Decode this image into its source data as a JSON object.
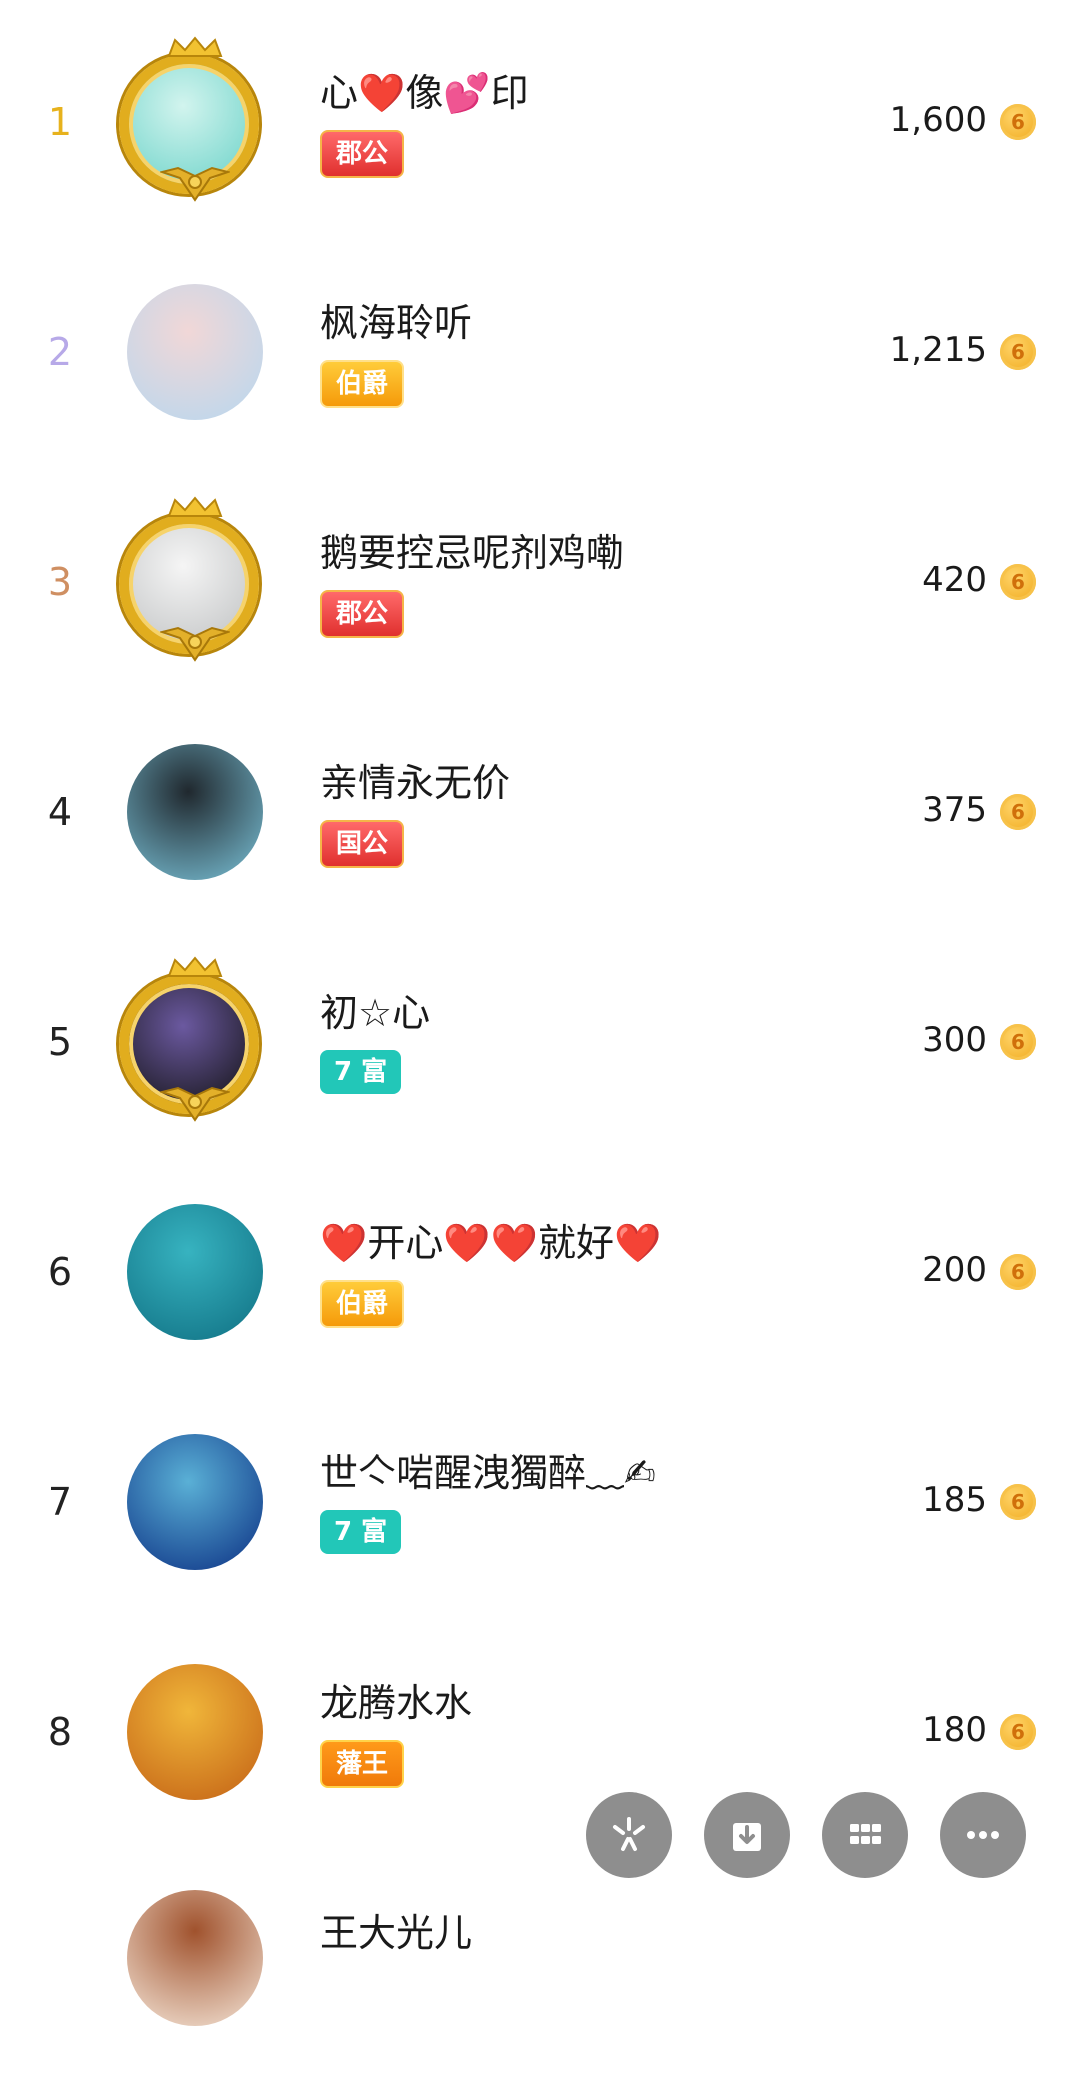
{
  "leaderboard": [
    {
      "rank": "1",
      "name": "心❤️像💕印",
      "badge": "郡公",
      "score": "1,600",
      "rank_color": "#e7b21d",
      "badge_style": "red",
      "avatar_colors": [
        "#6ad2c8",
        "#d2f4ee"
      ],
      "framed": true
    },
    {
      "rank": "2",
      "name": "枫海聆听",
      "badge": "伯爵",
      "score": "1,215",
      "rank_color": "#b7a9e8",
      "badge_style": "orange",
      "avatar_colors": [
        "#b7d7ef",
        "#f1d7d7"
      ],
      "framed": false
    },
    {
      "rank": "3",
      "name": "鹅要控忌呢剂鸡嘞",
      "badge": "郡公",
      "score": "420",
      "rank_color": "#cf8f62",
      "badge_style": "red",
      "avatar_colors": [
        "#bfc1c2",
        "#f5f5f5"
      ],
      "framed": true
    },
    {
      "rank": "4",
      "name": "亲情永无价",
      "badge": "国公",
      "score": "375",
      "rank_color": "#222222",
      "badge_style": "red",
      "avatar_colors": [
        "#7bc3d9",
        "#20282e"
      ],
      "framed": false
    },
    {
      "rank": "5",
      "name": "初☆心",
      "badge": "7 富",
      "score": "300",
      "rank_color": "#222222",
      "badge_style": "teal",
      "avatar_colors": [
        "#111111",
        "#6b59a0"
      ],
      "framed": true
    },
    {
      "rank": "6",
      "name": "❤️开心❤️❤️就好❤️",
      "badge": "伯爵",
      "score": "200",
      "rank_color": "#222222",
      "badge_style": "orange",
      "avatar_colors": [
        "#0f6f82",
        "#37b3c0"
      ],
      "framed": false
    },
    {
      "rank": "7",
      "name": "世亽啱醒洩獨醉﹏✍",
      "badge": "7 富",
      "score": "185",
      "rank_color": "#222222",
      "badge_style": "teal",
      "avatar_colors": [
        "#0b2f83",
        "#5ab0d6"
      ],
      "framed": false
    },
    {
      "rank": "8",
      "name": "龙腾水水",
      "badge": "藩王",
      "score": "180",
      "rank_color": "#222222",
      "badge_style": "king",
      "avatar_colors": [
        "#c25f14",
        "#f0b63a"
      ],
      "framed": false
    }
  ],
  "partial_row": {
    "name": "王大光儿"
  },
  "coin_icon_text": "6",
  "fabs": [
    {
      "icon": "share-icon"
    },
    {
      "icon": "download-icon"
    },
    {
      "icon": "grid-icon"
    },
    {
      "icon": "more-icon"
    }
  ]
}
